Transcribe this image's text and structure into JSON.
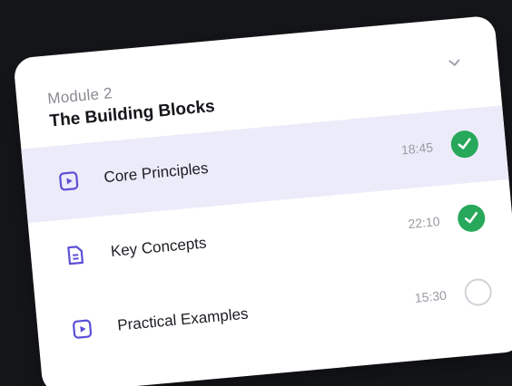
{
  "module": {
    "label": "Module 2",
    "title": "The Building Blocks",
    "expand_icon": "chevron-down-icon"
  },
  "lessons": [
    {
      "title": "Core Principles",
      "duration": "18:45",
      "type_icon": "video-icon",
      "completed": true,
      "active": true
    },
    {
      "title": "Key Concepts",
      "duration": "22:10",
      "type_icon": "document-icon",
      "completed": true,
      "active": false
    },
    {
      "title": "Practical Examples",
      "duration": "15:30",
      "type_icon": "video-icon",
      "completed": false,
      "active": false
    }
  ],
  "colors": {
    "accent": "#5b4fd6",
    "active_row": "#ecebf9",
    "complete": "#27a85a",
    "background": "#15161a"
  }
}
